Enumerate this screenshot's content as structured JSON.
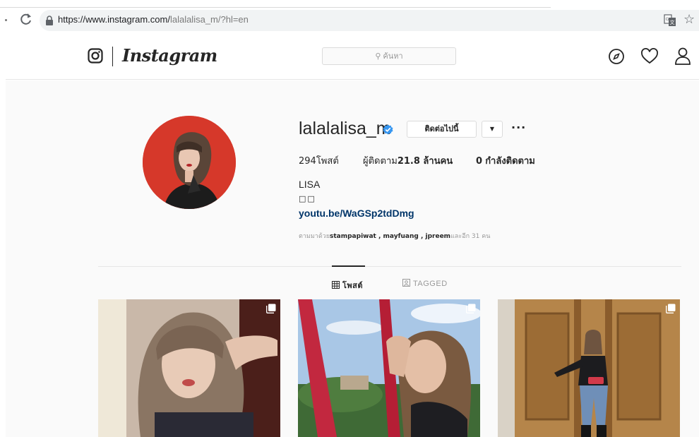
{
  "browser": {
    "url_host": "https://www.instagram.com/",
    "url_path": "lalalalisa_m/?hl=en"
  },
  "header": {
    "wordmark": "Instagram",
    "search_placeholder": "ค้นหา",
    "icons": [
      "instagram-logo-icon",
      "compass-icon",
      "heart-icon",
      "user-icon"
    ]
  },
  "profile": {
    "username": "lalalalisa_m",
    "follow_label": "ติดต่อไปนี้",
    "dropdown_label": "▼",
    "more_label": "···",
    "stats": {
      "posts_count": "294",
      "posts_label": "โพสต์",
      "followers_label": "ผู้ติดตาม",
      "followers_count": "21.8 ล้านคน",
      "following_count": "0",
      "following_label": "กำลังติดตาม"
    },
    "bio_name": "LISA",
    "bio_emoji": "□□",
    "bio_link": "youtu.be/WaGSp2tdDmg",
    "followed_by_prefix": "ตามมาด้วย",
    "followed_by_names": "stampapiwat , mayfuang , jpreem",
    "followed_by_suffix": "และอีก 31 คน"
  },
  "tabs": {
    "posts": "โพสต์",
    "tagged": "TAGGED"
  },
  "colors": {
    "accent_link": "#003569",
    "verified": "#3897f0",
    "avatar_bg": "#d6382a"
  }
}
